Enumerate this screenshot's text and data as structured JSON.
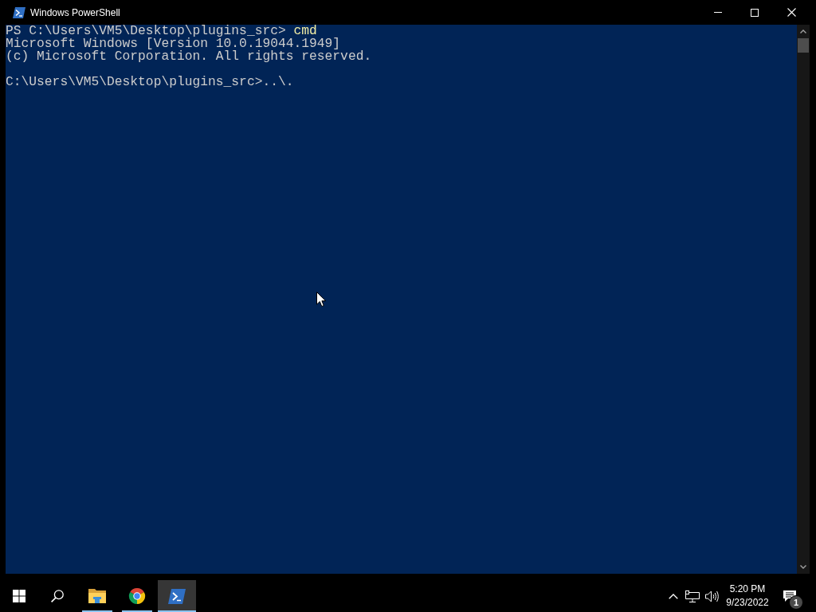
{
  "window": {
    "title": "Windows PowerShell"
  },
  "console": {
    "lines": [
      {
        "kind": "text",
        "text": "PS C:\\Users\\VM5\\Desktop\\plugins_src> ",
        "command": "cmd"
      },
      {
        "kind": "text",
        "text": "Microsoft Windows [Version 10.0.19044.1949]"
      },
      {
        "kind": "text",
        "text": "(c) Microsoft Corporation. All rights reserved."
      },
      {
        "kind": "blank"
      },
      {
        "kind": "text",
        "text": "C:\\Users\\VM5\\Desktop\\plugins_src>..\\."
      }
    ]
  },
  "taskbar": {
    "apps": [
      {
        "kind": "folder",
        "running": true,
        "selected": false
      },
      {
        "kind": "browser",
        "running": true,
        "selected": false
      },
      {
        "kind": "shell",
        "running": true,
        "selected": true
      }
    ],
    "clock": {
      "time": "5:20 PM",
      "date": "9/23/2022"
    },
    "notifications": {
      "count": "1"
    }
  }
}
